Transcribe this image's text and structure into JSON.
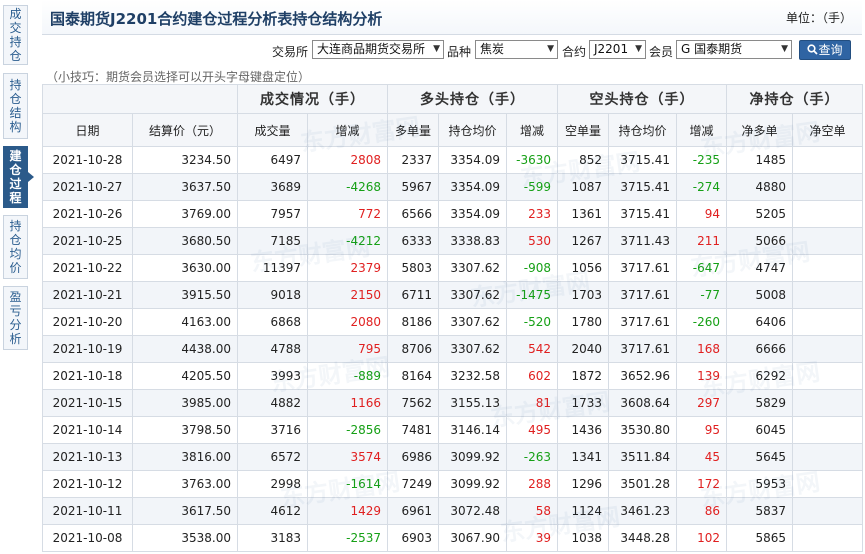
{
  "sidebar": {
    "tabs": [
      {
        "label": "成交持仓"
      },
      {
        "label": "持仓结构"
      },
      {
        "label": "建仓过程",
        "active": true
      },
      {
        "label": "持仓均价"
      },
      {
        "label": "盈亏分析"
      }
    ]
  },
  "header": {
    "title": "国泰期货J2201合约建仓过程分析表持仓结构分析",
    "unit": "单位：（手）"
  },
  "filters": {
    "exchange_label": "交易所",
    "exchange_value": "大连商品期货交易所",
    "variety_label": "品种",
    "variety_value": "焦炭",
    "contract_label": "合约",
    "contract_value": "J2201",
    "member_label": "会员",
    "member_value": "G 国泰期货",
    "search_label": "查询"
  },
  "tip": "（小技巧：期货会员选择可以开头字母键盘定位）",
  "watermark": "东方财富网",
  "table": {
    "groups": [
      "",
      "成交情况（手）",
      "多头持仓（手）",
      "空头持仓（手）",
      "净持仓（手）"
    ],
    "columns": [
      "日期",
      "结算价（元）",
      "成交量",
      "增减",
      "多单量",
      "持仓均价",
      "增减",
      "空单量",
      "持仓均价",
      "增减",
      "净多单",
      "净空单"
    ],
    "rows": [
      [
        "2021-10-28",
        "3234.50",
        "6497",
        "2808",
        "2337",
        "3354.09",
        "-3630",
        "852",
        "3715.41",
        "-235",
        "1485",
        ""
      ],
      [
        "2021-10-27",
        "3637.50",
        "3689",
        "-4268",
        "5967",
        "3354.09",
        "-599",
        "1087",
        "3715.41",
        "-274",
        "4880",
        ""
      ],
      [
        "2021-10-26",
        "3769.00",
        "7957",
        "772",
        "6566",
        "3354.09",
        "233",
        "1361",
        "3715.41",
        "94",
        "5205",
        ""
      ],
      [
        "2021-10-25",
        "3680.50",
        "7185",
        "-4212",
        "6333",
        "3338.83",
        "530",
        "1267",
        "3711.43",
        "211",
        "5066",
        ""
      ],
      [
        "2021-10-22",
        "3630.00",
        "11397",
        "2379",
        "5803",
        "3307.62",
        "-908",
        "1056",
        "3717.61",
        "-647",
        "4747",
        ""
      ],
      [
        "2021-10-21",
        "3915.50",
        "9018",
        "2150",
        "6711",
        "3307.62",
        "-1475",
        "1703",
        "3717.61",
        "-77",
        "5008",
        ""
      ],
      [
        "2021-10-20",
        "4163.00",
        "6868",
        "2080",
        "8186",
        "3307.62",
        "-520",
        "1780",
        "3717.61",
        "-260",
        "6406",
        ""
      ],
      [
        "2021-10-19",
        "4438.00",
        "4788",
        "795",
        "8706",
        "3307.62",
        "542",
        "2040",
        "3717.61",
        "168",
        "6666",
        ""
      ],
      [
        "2021-10-18",
        "4205.50",
        "3993",
        "-889",
        "8164",
        "3232.58",
        "602",
        "1872",
        "3652.96",
        "139",
        "6292",
        ""
      ],
      [
        "2021-10-15",
        "3985.00",
        "4882",
        "1166",
        "7562",
        "3155.13",
        "81",
        "1733",
        "3608.64",
        "297",
        "5829",
        ""
      ],
      [
        "2021-10-14",
        "3798.50",
        "3716",
        "-2856",
        "7481",
        "3146.14",
        "495",
        "1436",
        "3530.80",
        "95",
        "6045",
        ""
      ],
      [
        "2021-10-13",
        "3816.00",
        "6572",
        "3574",
        "6986",
        "3099.92",
        "-263",
        "1341",
        "3511.84",
        "45",
        "5645",
        ""
      ],
      [
        "2021-10-12",
        "3763.00",
        "2998",
        "-1614",
        "7249",
        "3099.92",
        "288",
        "1296",
        "3501.28",
        "172",
        "5953",
        ""
      ],
      [
        "2021-10-11",
        "3617.50",
        "4612",
        "1429",
        "6961",
        "3072.48",
        "58",
        "1124",
        "3461.23",
        "86",
        "5837",
        ""
      ],
      [
        "2021-10-08",
        "3538.00",
        "3183",
        "-2537",
        "6903",
        "3067.90",
        "39",
        "1038",
        "3448.28",
        "102",
        "5865",
        ""
      ]
    ]
  },
  "colors": {
    "accent": "#2b5a8a",
    "up": "#e02020",
    "down": "#16a016"
  }
}
